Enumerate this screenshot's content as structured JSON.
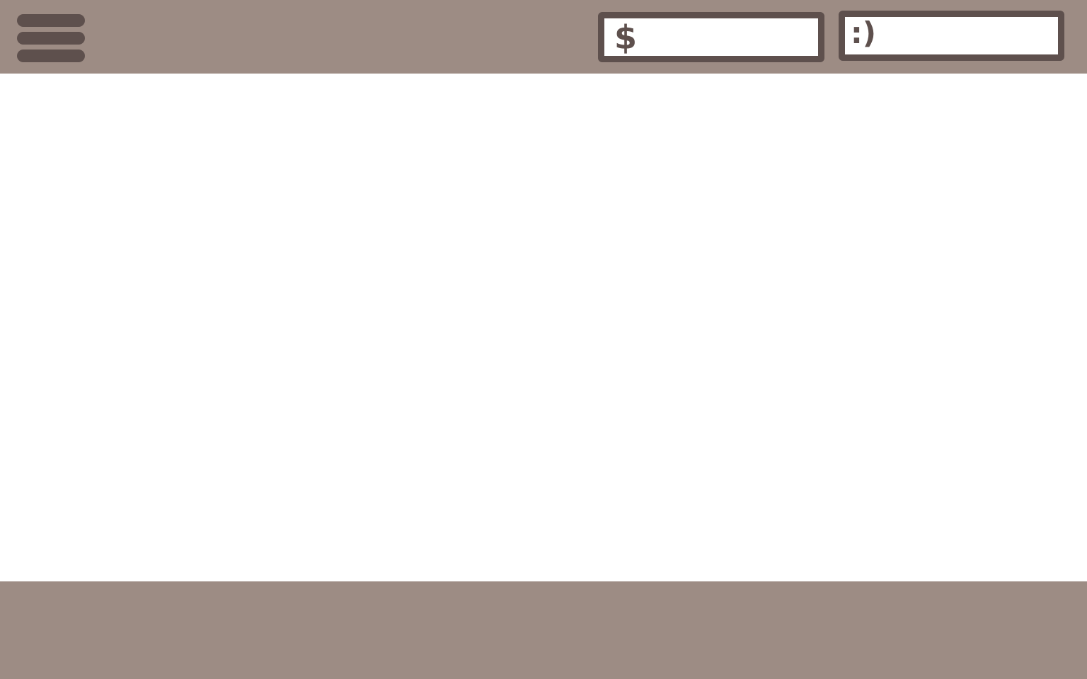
{
  "top_bar": {
    "menu_icon": "hamburger-menu-icon",
    "money": {
      "icon_text": "$",
      "value": ""
    },
    "mood": {
      "icon_text": ":)",
      "value": ""
    }
  },
  "colors": {
    "bar_background": "#9d8c84",
    "accent_dark": "#5e504d",
    "field_background": "#ffffff"
  }
}
